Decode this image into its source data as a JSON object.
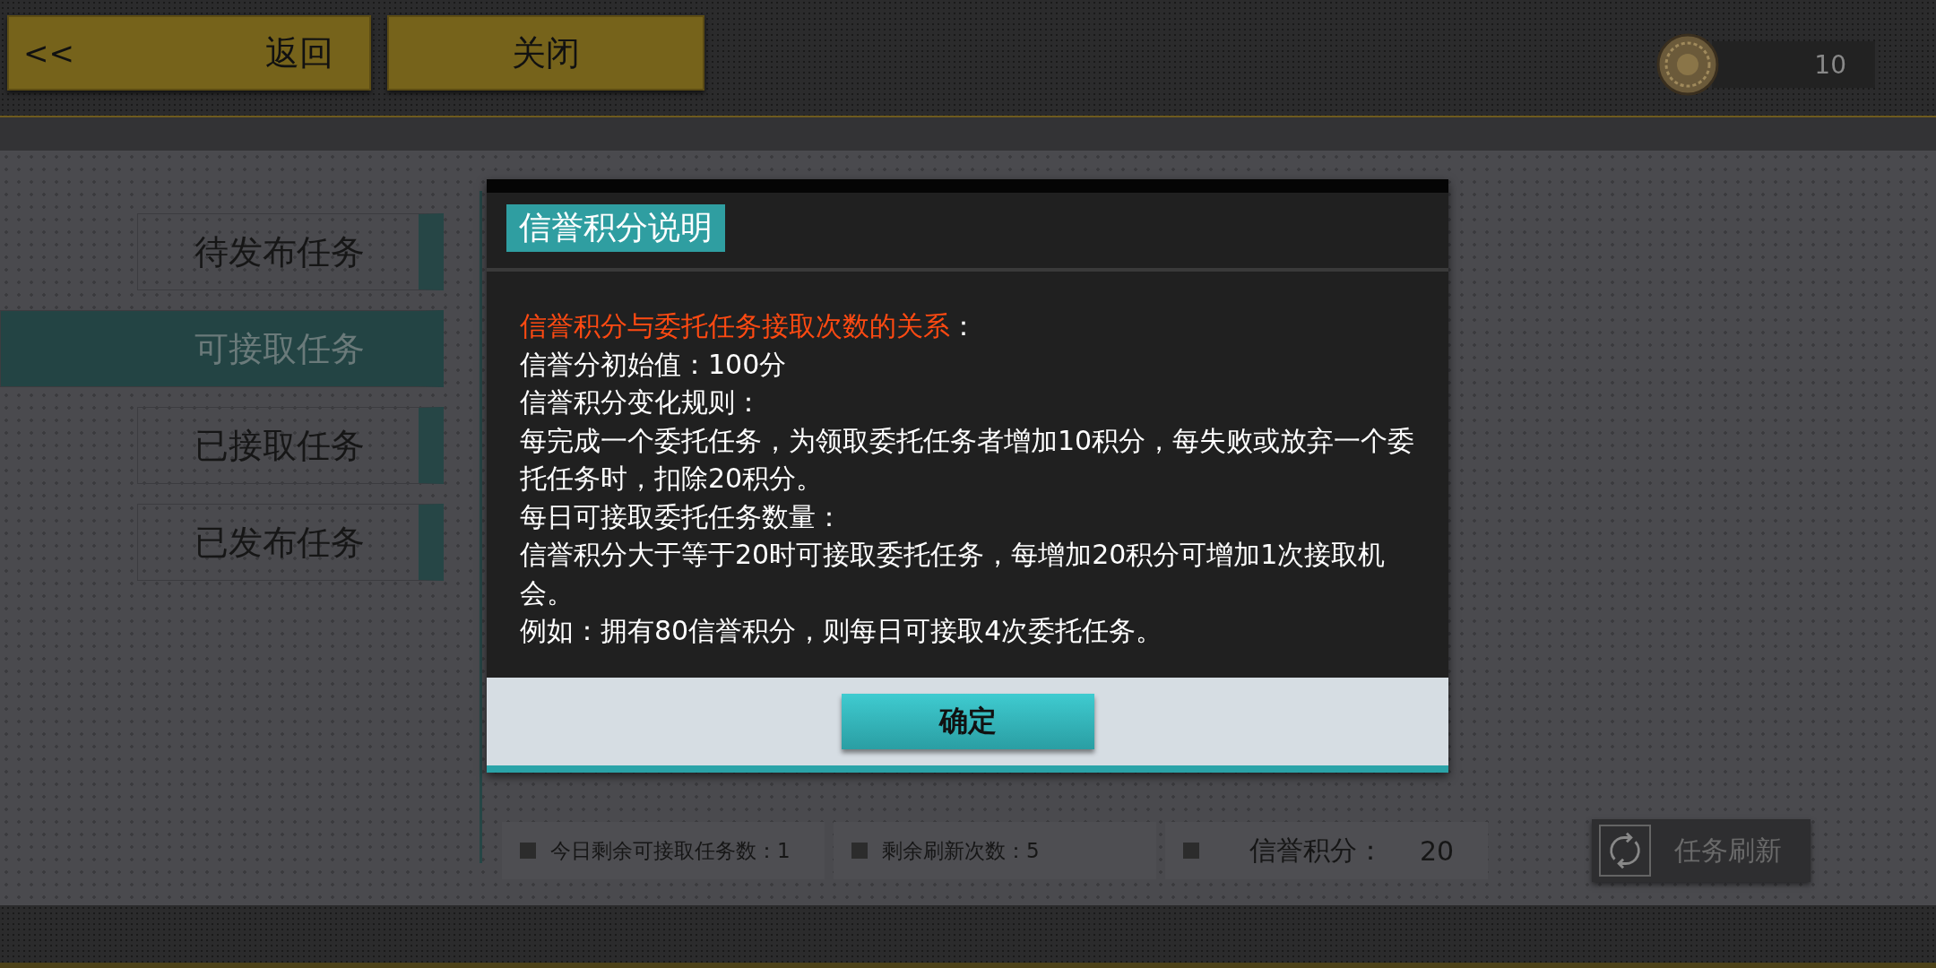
{
  "top_bar": {
    "back_button": {
      "arrow": "<<",
      "label": "返回"
    },
    "close_button": {
      "label": "关闭"
    },
    "coins": "10"
  },
  "sidebar": {
    "items": [
      {
        "label": "待发布任务",
        "selected": false
      },
      {
        "label": "可接取任务",
        "selected": true
      },
      {
        "label": "已接取任务",
        "selected": false
      },
      {
        "label": "已发布任务",
        "selected": false
      }
    ]
  },
  "stats": [
    {
      "kind": "inline",
      "label": "今日剩余可接取任务数：",
      "value": "1"
    },
    {
      "kind": "inline",
      "label": "剩余刷新次数：",
      "value": "5"
    },
    {
      "kind": "split",
      "label": "信誉积分：",
      "value": "20"
    }
  ],
  "refresh_button": {
    "label": "任务刷新"
  },
  "dialog": {
    "title": "信誉积分说明",
    "lines": [
      {
        "kind": "heading",
        "text": "信誉积分与委托任务接取次数的关系",
        "suffix": "："
      },
      {
        "kind": "text",
        "text": "信誉分初始值：100分"
      },
      {
        "kind": "text",
        "text": "信誉积分变化规则："
      },
      {
        "kind": "text",
        "text": "每完成一个委托任务，为领取委托任务者增加10积分，每失败或放弃一个委托任务时，扣除20积分。"
      },
      {
        "kind": "text",
        "text": "每日可接取委托任务数量："
      },
      {
        "kind": "text",
        "text": "信誉积分大于等于20时可接取委托任务，每增加20积分可增加1次接取机会。"
      },
      {
        "kind": "text",
        "text": "例如：拥有80信誉积分，则每日可接取4次委托任务。"
      }
    ],
    "confirm_button": {
      "label": "确定"
    }
  }
}
